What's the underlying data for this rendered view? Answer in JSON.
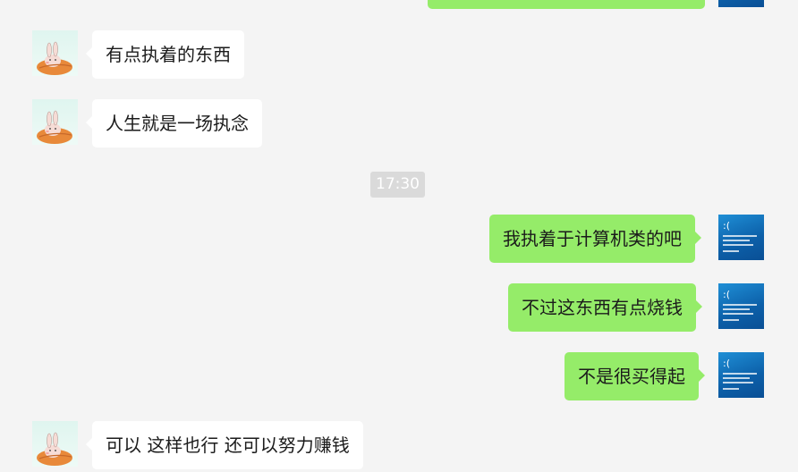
{
  "time_divider": "17:30",
  "messages": [
    {
      "side": "left",
      "text": "有点执着的东西"
    },
    {
      "side": "left",
      "text": "人生就是一场执念"
    },
    {
      "side": "right",
      "text": "我执着于计算机类的吧"
    },
    {
      "side": "right",
      "text": "不过这东西有点烧钱"
    },
    {
      "side": "right",
      "text": "不是很买得起"
    },
    {
      "side": "left",
      "text": "可以 这样也行 还可以努力赚钱"
    }
  ],
  "avatars": {
    "contact": "rabbit-avatar",
    "self": "bsod-avatar",
    "self_face": ":("
  },
  "colors": {
    "background": "#f4f4f4",
    "incoming_bubble": "#ffffff",
    "outgoing_bubble": "#95ec69",
    "time_badge": "#dadada"
  }
}
